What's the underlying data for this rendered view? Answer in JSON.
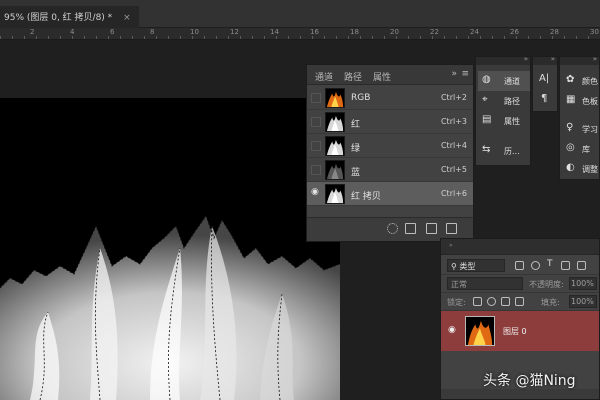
{
  "document": {
    "tab_title": "95% (图层 0, 红 拷贝/8) *",
    "close_glyph": "×",
    "ruler_labels": [
      "2",
      "4",
      "6",
      "8",
      "10",
      "12",
      "14",
      "16",
      "18",
      "20",
      "22",
      "24",
      "26",
      "28",
      "30"
    ]
  },
  "channels_panel": {
    "tabs": [
      {
        "label": "通道",
        "active": true
      },
      {
        "label": "路径",
        "active": false
      },
      {
        "label": "属性",
        "active": false
      }
    ],
    "collapse_glyph": "»",
    "menu_glyph": "≡",
    "rows": [
      {
        "name": "RGB",
        "shortcut": "Ctrl+2",
        "visible": false,
        "selected": false,
        "thumb": "color"
      },
      {
        "name": "红",
        "shortcut": "Ctrl+3",
        "visible": false,
        "selected": false,
        "thumb": "gray"
      },
      {
        "name": "绿",
        "shortcut": "Ctrl+4",
        "visible": false,
        "selected": false,
        "thumb": "gray"
      },
      {
        "name": "蓝",
        "shortcut": "Ctrl+5",
        "visible": false,
        "selected": false,
        "thumb": "dark"
      },
      {
        "name": "红 拷贝",
        "shortcut": "Ctrl+6",
        "visible": true,
        "selected": true,
        "thumb": "gray"
      }
    ]
  },
  "mini_panel_1": {
    "items": [
      {
        "icon": "◍",
        "label": "通道",
        "selected": true
      },
      {
        "icon": "⌖",
        "label": "路径",
        "selected": false
      },
      {
        "icon": "▤",
        "label": "属性",
        "selected": false
      },
      {
        "icon": "⇆",
        "label": "历...",
        "selected": false
      }
    ]
  },
  "mini_panel_2": {
    "items": [
      {
        "icon": "A|"
      },
      {
        "icon": "¶"
      }
    ]
  },
  "mini_panel_3": {
    "items": [
      {
        "icon": "✿",
        "label": "颜色"
      },
      {
        "icon": "▦",
        "label": "色板"
      },
      {
        "icon": "♀",
        "label": "学习"
      },
      {
        "icon": "◎",
        "label": "库"
      },
      {
        "icon": "◐",
        "label": "调整"
      }
    ]
  },
  "layers_panel": {
    "kind_filter": "类型",
    "blend_mode": "正常",
    "opacity_label": "不透明度:",
    "opacity_value": "100%",
    "lock_label": "锁定:",
    "fill_label": "填充:",
    "fill_value": "100%",
    "layer": {
      "name": "图层 0",
      "visible": true,
      "selected": true
    },
    "collapse_glyph": "»"
  },
  "watermark": "头条 @猫Ning",
  "colors": {
    "canvas_bg": "#1f1f1f",
    "panel_bg": "#424242",
    "selected_row": "#5d5d5d",
    "selected_layer": "#8e3d3d"
  }
}
